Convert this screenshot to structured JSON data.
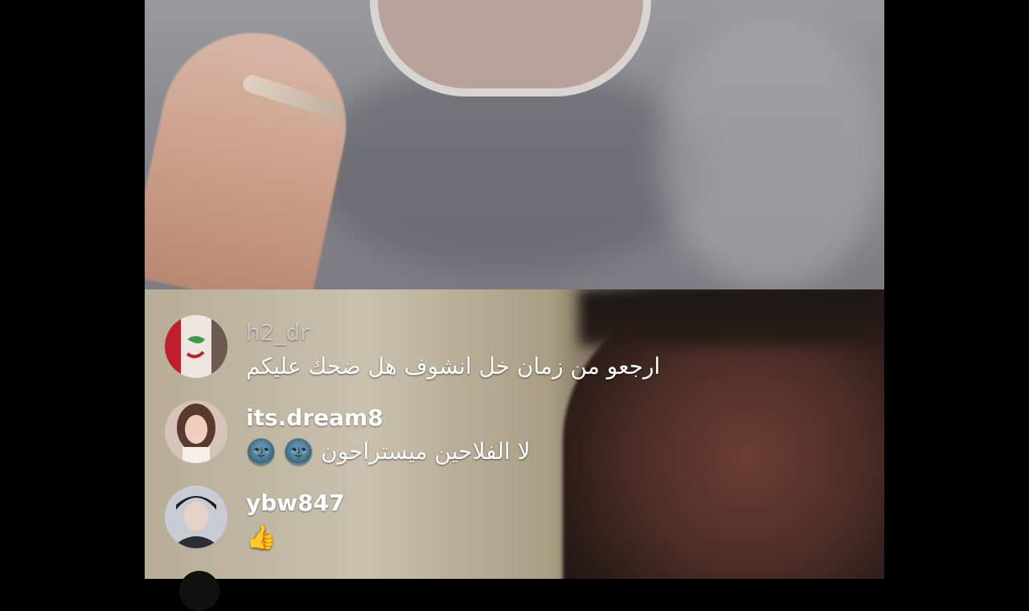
{
  "live_stream": {
    "comments": [
      {
        "username": "h2_dr",
        "message": "ارجعو من زمان خل انشوف هل ضحك عليكم",
        "emoji": "",
        "faded": true
      },
      {
        "username": "its.dream8",
        "message": "لا الفلاحين ميستراحون",
        "emoji": "🌚 🌚",
        "faded": false
      },
      {
        "username": "ybw847",
        "message": "",
        "emoji": "👍",
        "faded": false
      }
    ]
  },
  "colors": {
    "bar": "#000000",
    "text": "#ffffff",
    "faded_username": "#ffffff8c"
  }
}
